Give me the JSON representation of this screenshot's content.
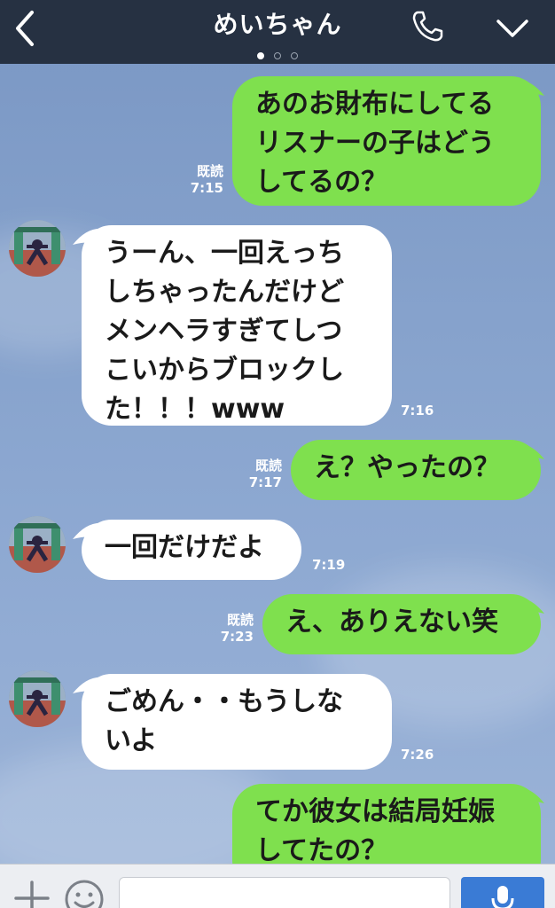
{
  "header": {
    "title": "めいちゃん",
    "page_dots": 3,
    "active_dot": 0,
    "icons": [
      "back-arrow-icon",
      "phone-icon",
      "chevron-down-icon"
    ]
  },
  "messages": [
    {
      "side": "out",
      "text_lines": [
        "あのお財布にしてる",
        "リスナーの子はどう",
        "してるの？"
      ],
      "read": "既読",
      "time": "7:15"
    },
    {
      "side": "in",
      "text_lines": [
        "うーん、一回えっち",
        "しちゃったんだけど",
        "メンヘラすぎてしつ",
        "こいからブロックし",
        "た！！！www"
      ],
      "time": "7:16"
    },
    {
      "side": "out",
      "text_lines": [
        "え？やったの？"
      ],
      "read": "既読",
      "time": "7:17"
    },
    {
      "side": "in",
      "text_lines": [
        "一回だけだよ"
      ],
      "time": "7:19"
    },
    {
      "side": "out",
      "text_lines": [
        "え、ありえない笑"
      ],
      "read": "既読",
      "time": "7:23"
    },
    {
      "side": "in",
      "text_lines": [
        "ごめん・・もうしな",
        "いよ"
      ],
      "time": "7:26"
    },
    {
      "side": "out",
      "text_lines": [
        "てか彼女は結局妊娠",
        "してたの？"
      ]
    }
  ],
  "composer": {
    "icons": [
      "plus-icon",
      "emoji-icon",
      "microphone-icon"
    ],
    "colors": {
      "mic_button": "#3a7bd5"
    }
  },
  "colors": {
    "header_bg": "#263142",
    "outgoing_bubble": "#7fe04e",
    "incoming_bubble": "#ffffff",
    "chat_bg": "#86a2cc"
  }
}
